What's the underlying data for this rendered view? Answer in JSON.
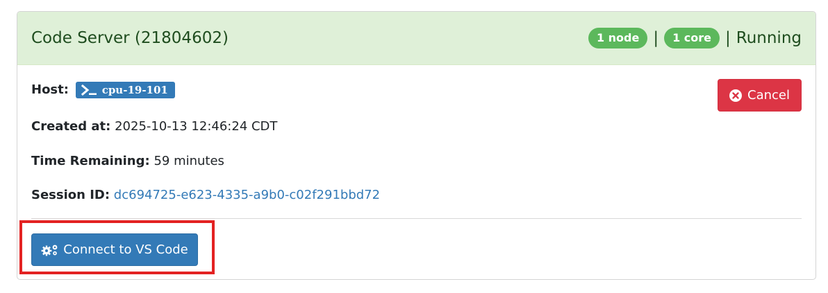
{
  "session": {
    "title": "Code Server (21804602)",
    "nodes_badge": "1 node",
    "cores_badge": "1 core",
    "separator": "|",
    "status": "Running"
  },
  "details": {
    "host_label": "Host:",
    "host_value": "cpu-19-101",
    "created_label": "Created at:",
    "created_value": "2025-10-13 12:46:24 CDT",
    "time_label": "Time Remaining:",
    "time_value": "59 minutes",
    "session_label": "Session ID:",
    "session_value": "dc694725-e623-4335-a9b0-c02f291bbd72"
  },
  "actions": {
    "cancel_label": "Cancel",
    "connect_label": "Connect to VS Code"
  },
  "colors": {
    "header_bg": "#dff0d8",
    "pill_green": "#5cb85c",
    "primary": "#337ab7",
    "danger": "#dc3545",
    "highlight": "#e32222"
  },
  "icons": [
    "terminal-icon",
    "x-circle-icon",
    "gears-icon"
  ]
}
